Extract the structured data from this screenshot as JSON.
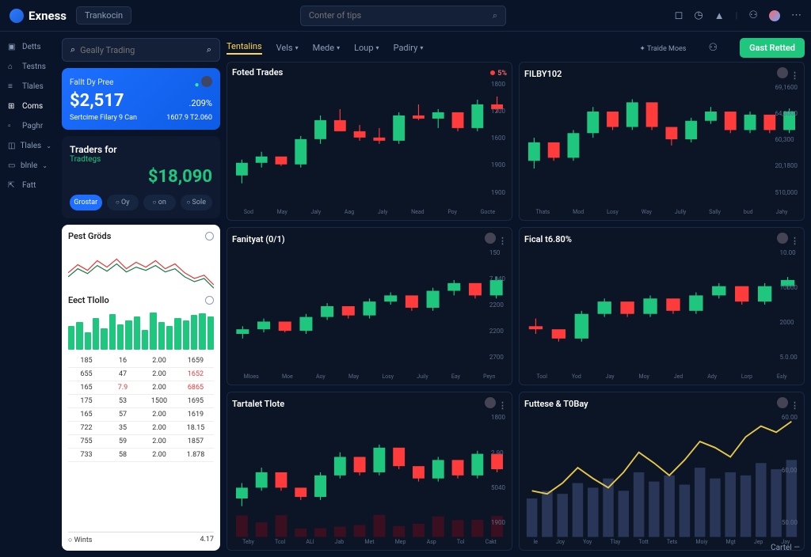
{
  "brand": "Exness",
  "top_button": "Trankocin",
  "search_placeholder": "Conter of tips",
  "header": {
    "stat_label": "Traide Moes",
    "cta": "Gast Retted"
  },
  "nav": [
    {
      "icon": "▣",
      "label": "Detts"
    },
    {
      "icon": "⌂",
      "label": "Testns"
    },
    {
      "icon": "≡",
      "label": "Tlales"
    },
    {
      "icon": "⊞",
      "label": "Coms"
    },
    {
      "icon": "▫",
      "label": "Paghr"
    },
    {
      "icon": "◫",
      "label": "Tlales"
    },
    {
      "icon": "▭",
      "label": "blnle"
    },
    {
      "icon": "⇱",
      "label": "Fatt"
    }
  ],
  "panel_search": "Geally Trading",
  "blue_card": {
    "title": "Fallt Dy Pree",
    "amount": "$2,517",
    "pct": ".209%",
    "sub_left": "Sertcime Filary 9 Can",
    "sub_right": "1607.9 T2.060"
  },
  "traders_card": {
    "label": "Traders for",
    "sub": "Tradtegs",
    "value": "$18,090",
    "actions": [
      "Grostar",
      "Oy",
      "on",
      "Sole"
    ]
  },
  "pest_title": "Pest Gröds",
  "eect_title": "Eect Tlollo",
  "bars": [
    60,
    70,
    45,
    80,
    55,
    90,
    65,
    75,
    85,
    50,
    95,
    70,
    60,
    80,
    75,
    88,
    92,
    85
  ],
  "table": [
    [
      "185",
      "16",
      "2.00",
      "1659"
    ],
    [
      "655",
      "47",
      "2.00",
      "1652"
    ],
    [
      "165",
      "7.9",
      "2.00",
      "6865"
    ],
    [
      "175",
      "53",
      "1500",
      "1695"
    ],
    [
      "165",
      "57",
      "2.00",
      "1619"
    ],
    [
      "722",
      "35",
      "2.00",
      "18.15"
    ],
    [
      "755",
      "59",
      "2.00",
      "1857"
    ],
    [
      "733",
      "58",
      "2.00",
      "1.878"
    ]
  ],
  "wins_label": "Wints",
  "wins_val": "4.17",
  "tabs": [
    "Tentalins",
    "Vels",
    "Mede",
    "Loup",
    "Padiry"
  ],
  "charts": [
    {
      "title": "Foted Trades",
      "badge": "5%",
      "xaxis": [
        "Sod",
        "May",
        "Jaly",
        "Aag",
        "Jaly",
        "Nead",
        "Poy",
        "Gocte"
      ],
      "yaxis": [
        "1800",
        "1200",
        "1600",
        "1900",
        "1900"
      ]
    },
    {
      "title": "FILBY102",
      "xaxis": [
        "Thats",
        "Mod",
        "Losy",
        "Way",
        "Jully",
        "Sally",
        "bud",
        "Jahy"
      ],
      "yaxis": [
        "69,1600",
        "64,3000",
        "60,300",
        "20,1800",
        "510,000"
      ]
    },
    {
      "title": "Fanityat (0/1)",
      "xaxis": [
        "Mloes",
        "Moe",
        "Aoy",
        "May",
        "Losy",
        "Juily",
        "Eay",
        "Peyn"
      ],
      "yaxis": [
        "150",
        "7.040",
        "2200",
        "2200",
        "2700"
      ]
    },
    {
      "title": "Fical t6.80%",
      "xaxis": [
        "Tool",
        "Yod",
        "Jay",
        "Moy",
        "Jed",
        "Ady",
        "Lorp",
        "Esly"
      ],
      "yaxis": [
        "10.00",
        "10000",
        "2000",
        "5.0.00"
      ]
    },
    {
      "title": "Tartalet Tlote",
      "xaxis": [
        "Teby",
        "Tcol",
        "ALl",
        "Jab",
        "Met",
        "Mep",
        "Asp",
        "Tol",
        "Cakt"
      ],
      "yaxis": [
        "1800",
        "2.90",
        "5040",
        "1900"
      ]
    },
    {
      "title": "Futtese & T0Bay",
      "xaxis": [
        "le",
        "Joy",
        "Yoy",
        "Tlay",
        "Tott",
        "Tets",
        "Moiy",
        "Mgt",
        "Jep",
        "Jay"
      ],
      "yaxis": [
        "60.00",
        "60,00",
        "50.00"
      ]
    }
  ],
  "footer": "Cartel —",
  "chart_data": [
    {
      "type": "candlestick",
      "title": "Foted Trades",
      "candles": [
        [
          20,
          30,
          15,
          28,
          1
        ],
        [
          28,
          35,
          25,
          32,
          1
        ],
        [
          32,
          28,
          26,
          27,
          0
        ],
        [
          27,
          45,
          25,
          43,
          1
        ],
        [
          43,
          58,
          40,
          55,
          1
        ],
        [
          55,
          62,
          50,
          48,
          0
        ],
        [
          48,
          52,
          42,
          44,
          0
        ],
        [
          44,
          50,
          40,
          42,
          0
        ],
        [
          42,
          60,
          40,
          58,
          1
        ],
        [
          58,
          65,
          55,
          56,
          0
        ],
        [
          56,
          62,
          50,
          60,
          1
        ],
        [
          60,
          55,
          48,
          50,
          0
        ],
        [
          50,
          68,
          48,
          65,
          1
        ],
        [
          65,
          70,
          60,
          62,
          0
        ]
      ]
    },
    {
      "type": "candlestick",
      "title": "FILBY102",
      "candles": [
        [
          30,
          45,
          25,
          42,
          1
        ],
        [
          42,
          38,
          30,
          32,
          0
        ],
        [
          32,
          50,
          30,
          48,
          1
        ],
        [
          48,
          65,
          45,
          62,
          1
        ],
        [
          62,
          58,
          50,
          52,
          0
        ],
        [
          52,
          70,
          50,
          68,
          1
        ],
        [
          68,
          60,
          50,
          52,
          0
        ],
        [
          52,
          48,
          40,
          44,
          0
        ],
        [
          44,
          58,
          42,
          56,
          1
        ],
        [
          56,
          65,
          54,
          62,
          1
        ],
        [
          62,
          58,
          48,
          50,
          0
        ],
        [
          50,
          62,
          48,
          60,
          1
        ],
        [
          60,
          56,
          48,
          50,
          0
        ],
        [
          50,
          64,
          48,
          62,
          1
        ]
      ]
    },
    {
      "type": "candlestick",
      "title": "Fanityat (0/1)",
      "candles": [
        [
          25,
          30,
          22,
          28,
          1
        ],
        [
          28,
          35,
          26,
          33,
          1
        ],
        [
          33,
          30,
          26,
          27,
          0
        ],
        [
          27,
          38,
          25,
          36,
          1
        ],
        [
          36,
          45,
          34,
          43,
          1
        ],
        [
          43,
          40,
          35,
          37,
          0
        ],
        [
          37,
          48,
          35,
          46,
          1
        ],
        [
          46,
          52,
          44,
          50,
          1
        ],
        [
          50,
          46,
          40,
          42,
          0
        ],
        [
          42,
          55,
          40,
          53,
          1
        ],
        [
          53,
          60,
          50,
          58,
          1
        ],
        [
          58,
          54,
          48,
          50,
          0
        ],
        [
          50,
          62,
          48,
          60,
          1
        ]
      ]
    },
    {
      "type": "candlestick",
      "title": "Fical t6.80%",
      "candles": [
        [
          30,
          35,
          25,
          28,
          0
        ],
        [
          28,
          25,
          20,
          22,
          0
        ],
        [
          22,
          40,
          20,
          38,
          1
        ],
        [
          38,
          48,
          36,
          46,
          1
        ],
        [
          46,
          42,
          36,
          38,
          0
        ],
        [
          38,
          50,
          36,
          48,
          1
        ],
        [
          48,
          44,
          38,
          40,
          0
        ],
        [
          40,
          52,
          38,
          50,
          1
        ],
        [
          50,
          58,
          48,
          56,
          1
        ],
        [
          56,
          52,
          44,
          46,
          0
        ],
        [
          46,
          58,
          44,
          56,
          1
        ],
        [
          56,
          62,
          54,
          60,
          1
        ]
      ]
    },
    {
      "type": "candlestick",
      "title": "Tartalet Tlote",
      "candles": [
        [
          25,
          35,
          20,
          32,
          1
        ],
        [
          32,
          45,
          30,
          42,
          1
        ],
        [
          42,
          38,
          30,
          32,
          0
        ],
        [
          32,
          28,
          24,
          26,
          0
        ],
        [
          26,
          42,
          24,
          40,
          1
        ],
        [
          40,
          55,
          38,
          52,
          1
        ],
        [
          52,
          48,
          40,
          42,
          0
        ],
        [
          42,
          60,
          40,
          58,
          1
        ],
        [
          58,
          52,
          44,
          46,
          0
        ],
        [
          46,
          42,
          36,
          38,
          0
        ],
        [
          38,
          52,
          36,
          50,
          1
        ],
        [
          50,
          44,
          38,
          40,
          0
        ],
        [
          40,
          56,
          38,
          54,
          1
        ],
        [
          54,
          48,
          42,
          44,
          0
        ]
      ]
    },
    {
      "type": "line+bar",
      "title": "Futtese & T0Bay",
      "line": [
        30,
        28,
        35,
        45,
        38,
        32,
        42,
        55,
        48,
        40,
        50,
        62,
        58,
        52,
        65,
        72,
        68,
        75
      ],
      "bars": [
        25,
        30,
        28,
        35,
        32,
        38,
        30,
        42,
        36,
        40,
        34,
        45,
        38,
        42,
        40,
        48,
        44,
        50
      ]
    }
  ]
}
